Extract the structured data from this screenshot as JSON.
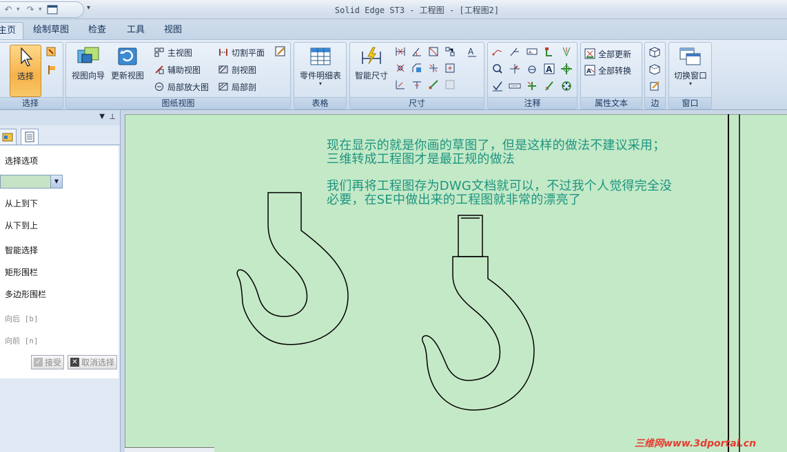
{
  "window": {
    "title": "Solid Edge ST3 - 工程图 - [工程图2]"
  },
  "quick_access": {
    "customize_glyph": "▾"
  },
  "tabs": [
    {
      "label": "主页",
      "active": true
    },
    {
      "label": "绘制草图"
    },
    {
      "label": "检查"
    },
    {
      "label": "工具"
    },
    {
      "label": "视图"
    }
  ],
  "ribbon": {
    "select_group": {
      "label": "选择",
      "select_button": "选择"
    },
    "drawing_views": {
      "label": "图纸视图",
      "view_wizard": "视图向导",
      "update_views": "更新视图",
      "principal": "主视图",
      "auxiliary": "辅助视图",
      "detail": "局部放大图",
      "cutting_plane": "切割平面",
      "section": "剖视图",
      "broken_out": "局部剖"
    },
    "tables": {
      "label": "表格",
      "parts_list": "零件明细表"
    },
    "dimension": {
      "label": "尺寸",
      "smart_dimension": "智能尺寸"
    },
    "annotation": {
      "label": "注释"
    },
    "attribute_text": {
      "label": "属性文本",
      "update_all": "全部更新",
      "convert_all": "全部转换"
    },
    "edge": {
      "label": "边"
    },
    "window": {
      "label": "窗口",
      "switch_window": "切换窗口"
    }
  },
  "panel": {
    "options_title": "选择选项",
    "items": [
      "从上到下",
      "从下到上",
      "智能选择",
      "矩形围栏",
      "多边形围栏"
    ],
    "back": "向后 [b]",
    "forward": "向前 [n]",
    "accept": "接受",
    "deselect": "取消选择"
  },
  "sheet": {
    "note_line1": "现在显示的就是你画的草图了，但是这样的做法不建议采用；",
    "note_line2": "三维转成工程图才是最正规的做法",
    "note_line3": "我们再将工程图存为DWG文档就可以，不过我个人觉得完全没",
    "note_line4": "必要，在SE中做出来的工程图就非常的漂亮了",
    "note_color": "#1d9580",
    "background": "#c4e9c7"
  },
  "watermark": "三维网www.3dportal.cn"
}
